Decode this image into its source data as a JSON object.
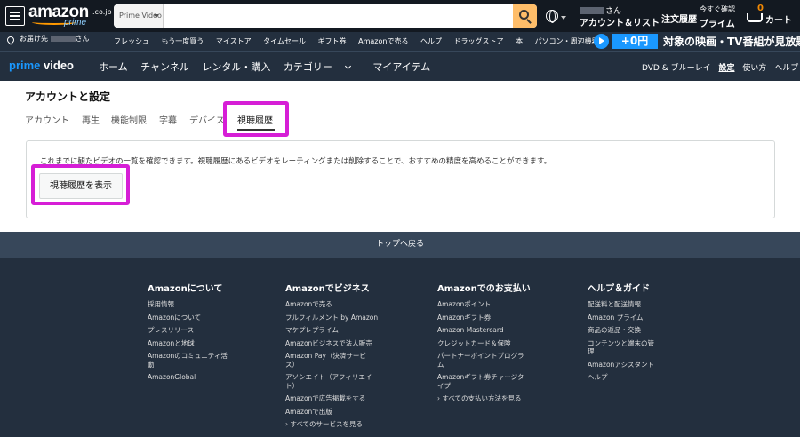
{
  "header": {
    "logo": {
      "word": "amazon",
      "tld": ".co.jp",
      "sub": "prime"
    },
    "search": {
      "department": "Prime Video",
      "placeholder": ""
    },
    "account": {
      "greeting_suffix": "さん",
      "label": "アカウント＆リスト"
    },
    "orders": "注文履歴",
    "prime": {
      "line1": "今すぐ確認",
      "line2": "プライム"
    },
    "cart": {
      "count": "0",
      "label": "カート"
    }
  },
  "subnav": {
    "deliver": {
      "prefix": "お届け先",
      "suffix": "さん"
    },
    "links": [
      "フレッシュ",
      "もう一度買う",
      "マイストア",
      "タイムセール",
      "ギフト券",
      "Amazonで売る",
      "ヘルプ",
      "ドラッグストア",
      "本",
      "パソコン・周辺機器"
    ],
    "promo": {
      "price": "+0円",
      "message": "対象の映画・TV番組が見放題"
    }
  },
  "pvnav": {
    "logo_a": "prime",
    "logo_b": "video",
    "links": [
      "ホーム",
      "チャンネル",
      "レンタル・購入",
      "カテゴリー",
      "マイアイテム"
    ],
    "right": [
      "DVD & ブルーレイ",
      "設定",
      "使い方",
      "ヘルプ"
    ]
  },
  "main": {
    "title": "アカウントと設定",
    "tabs": [
      "アカウント",
      "再生",
      "機能制限",
      "字幕",
      "デバイス",
      "視聴履歴"
    ],
    "description": "これまでに観たビデオの一覧を確認できます。視聴履歴にあるビデオをレーティングまたは削除することで、おすすめの精度を高めることができます。",
    "button": "視聴履歴を表示"
  },
  "back_to_top": "トップへ戻る",
  "footer": {
    "columns": [
      {
        "heading": "Amazonについて",
        "items": [
          "採用情報",
          "Amazonについて",
          "プレスリリース",
          "Amazonと地球",
          "Amazonのコミュニティ活動",
          "AmazonGlobal"
        ]
      },
      {
        "heading": "Amazonでビジネス",
        "items": [
          "Amazonで売る",
          "フルフィルメント by Amazon",
          "マケプレプライム",
          "Amazonビジネスで法人販売",
          "Amazon Pay（決済サービス）",
          "アソシエイト（アフィリエイト）",
          "Amazonで広告掲載をする",
          "Amazonで出版",
          "› すべてのサービスを見る"
        ]
      },
      {
        "heading": "Amazonでのお支払い",
        "items": [
          "Amazonポイント",
          "Amazonギフト券",
          "Amazon Mastercard",
          "クレジットカード＆保険",
          "パートナーポイントプログラム",
          "Amazonギフト券チャージタイプ",
          "› すべての支払い方法を見る"
        ]
      },
      {
        "heading": "ヘルプ＆ガイド",
        "items": [
          "配送料と配送情報",
          "Amazon プライム",
          "商品の返品・交換",
          "コンテンツと端末の管理",
          "Amazonアシスタント",
          "ヘルプ"
        ]
      }
    ]
  },
  "colors": {
    "nav_dark": "#131921",
    "nav_mid": "#232f3e",
    "accent_orange": "#febd69",
    "prime_blue": "#1a98ff",
    "highlight_magenta": "#d61ed6"
  }
}
